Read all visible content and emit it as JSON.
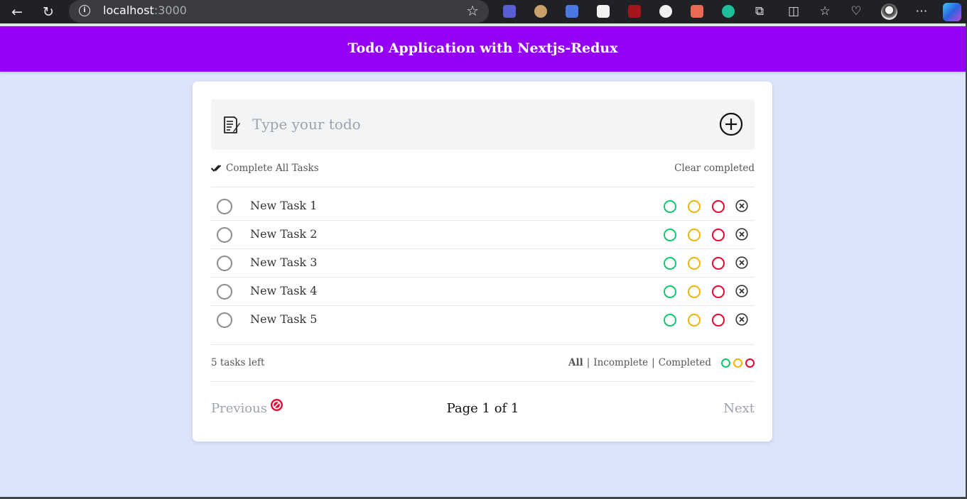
{
  "browser": {
    "url_host": "localhost",
    "url_port": ":3000"
  },
  "header": {
    "title": "Todo Application with Nextjs-Redux"
  },
  "input": {
    "placeholder": "Type your todo",
    "value": ""
  },
  "actions": {
    "complete_all": "Complete All Tasks",
    "clear_completed": "Clear completed"
  },
  "todos": [
    {
      "text": "New Task 1",
      "completed": false
    },
    {
      "text": "New Task 2",
      "completed": false
    },
    {
      "text": "New Task 3",
      "completed": false
    },
    {
      "text": "New Task 4",
      "completed": false
    },
    {
      "text": "New Task 5",
      "completed": false
    }
  ],
  "status": {
    "tasks_left": "5 tasks left",
    "filters": [
      "All",
      "Incomplete",
      "Completed"
    ],
    "active_filter": "All"
  },
  "pagination": {
    "previous": "Previous",
    "page_info": "Page 1 of 1",
    "next": "Next"
  },
  "colors": {
    "header_bg": "#9500f5",
    "page_bg": "#dce4fb",
    "priority_green": "#10c76a",
    "priority_yellow": "#efb508",
    "priority_red": "#e5062f"
  }
}
